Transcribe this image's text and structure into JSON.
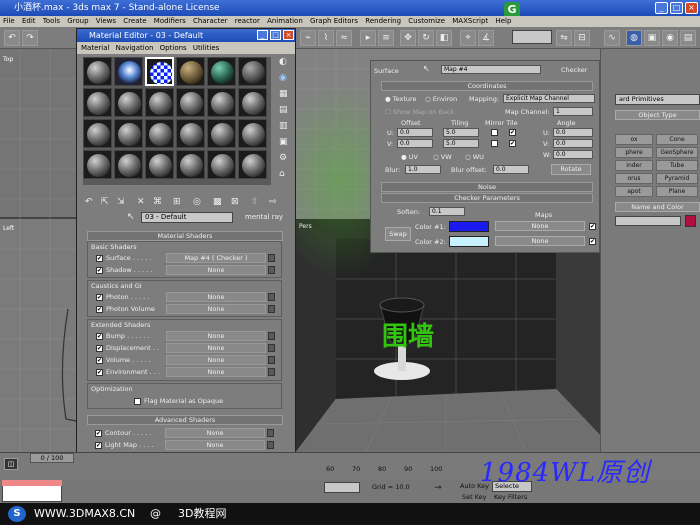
{
  "app": {
    "title": "小酒杯.max - 3ds max 7 - Stand-alone License",
    "menu": [
      "File",
      "Edit",
      "Tools",
      "Group",
      "Views",
      "Create",
      "Modifiers",
      "Character",
      "reactor",
      "Animation",
      "Graph Editors",
      "Rendering",
      "Customize",
      "MAXScript",
      "Help"
    ]
  },
  "viewports": {
    "top_label": "Top",
    "left_label": "Left",
    "persp_label": "Pers"
  },
  "material_editor": {
    "title": "Material Editor - 03 - Default",
    "menu": [
      "Material",
      "Navigation",
      "Options",
      "Utilities"
    ],
    "material_name": "03 - Default",
    "material_type": "mental ray",
    "rollout_material_shaders": "Material Shaders",
    "basic_shaders": {
      "label": "Basic Shaders",
      "surface_label": "Surface . . . . .",
      "surface_map": "Map #4  ( Checker )",
      "shadow_label": "Shadow . . . . .",
      "shadow_map": "None"
    },
    "caustics": {
      "label": "Caustics and GI",
      "photon_label": "Photon . . . . .",
      "photon_map": "None",
      "photon_volume_label": "Photon Volume",
      "photon_volume_map": "None"
    },
    "extended": {
      "label": "Extended Shaders",
      "bump_label": "Bump . . . . . .",
      "bump_map": "None",
      "displacement_label": "Displacement . .",
      "displacement_map": "None",
      "volume_label": "Volume . . . . .",
      "volume_map": "None",
      "environment_label": "Environment . . .",
      "environment_map": "None"
    },
    "optimization": {
      "label": "Optimization",
      "flag_label": "Flag Material as Opaque"
    },
    "rollout_advanced": "Advanced Shaders",
    "advanced": {
      "contour_label": "Contour . . . . .",
      "contour_map": "None",
      "lightmap_label": "Light Map . . . .",
      "lightmap_map": "None"
    }
  },
  "checker_panel": {
    "surface_label": "Surface",
    "map_name": "Map #4",
    "map_type": "Checker",
    "coordinates_header": "Coordinates",
    "texture_label": "Texture",
    "environ_label": "Environ",
    "mapping_label": "Mapping:",
    "mapping_value": "Explicit Map Channel",
    "show_map_label": "Show Map on Back",
    "map_channel_label": "Map Channel:",
    "map_channel_value": "1",
    "offset_label": "Offset",
    "tiling_label": "Tiling",
    "mirror_tile_label": "Mirror Tile",
    "angle_label": "Angle",
    "u_label": "U:",
    "v_label": "V:",
    "w_label": "W:",
    "u_offset": "0.0",
    "v_offset": "0.0",
    "u_tiling": "5.0",
    "v_tiling": "5.0",
    "u_angle": "0.0",
    "v_angle": "0.0",
    "w_angle": "0.0",
    "uv_label": "UV",
    "vw_label": "VW",
    "wu_label": "WU",
    "blur_label": "Blur:",
    "blur_value": "1.0",
    "blur_offset_label": "Blur offset:",
    "blur_offset_value": "0.0",
    "rotate_label": "Rotate",
    "noise_header": "Noise",
    "checker_header": "Checker Parameters",
    "soften_label": "Soften:",
    "soften_value": "0.1",
    "maps_label": "Maps",
    "swap_label": "Swap",
    "color1_label": "Color #1:",
    "color2_label": "Color #2:",
    "color1_map": "None",
    "color2_map": "None",
    "color1": "#1a1aee",
    "color2": "#c8f2ff"
  },
  "command_panel": {
    "dropdown": "ard Primitives",
    "object_type": "Object Type",
    "buttons": [
      "ox",
      "Cone",
      "phere",
      "GeoSphere",
      "inder",
      "Tube",
      "orus",
      "Pyramid",
      "apot",
      "Plane"
    ],
    "name_and_color": "Name and Color"
  },
  "timeline": {
    "counter": "0 / 100",
    "ticks": [
      "60",
      "70",
      "80",
      "90",
      "100"
    ],
    "grid_label": "Grid = 10.0",
    "auto_key": "Auto Key",
    "select_label": "Selecte",
    "set_key": "Set Key",
    "key_filters": "Key Filters"
  },
  "footer": {
    "site_url": "WWW.3DMAX8.CN",
    "at_sign": "@",
    "site_name": "3D教程网"
  },
  "watermark": {
    "text": "1984WL原创",
    "logo_text": "围墙"
  },
  "colors": {
    "accent_blue": "#1d4cb6",
    "checker_color1": "#1a1aee",
    "checker_color2": "#c8f2ff",
    "watermark_blue": "#2828ff",
    "logo_green": "#33c410"
  }
}
